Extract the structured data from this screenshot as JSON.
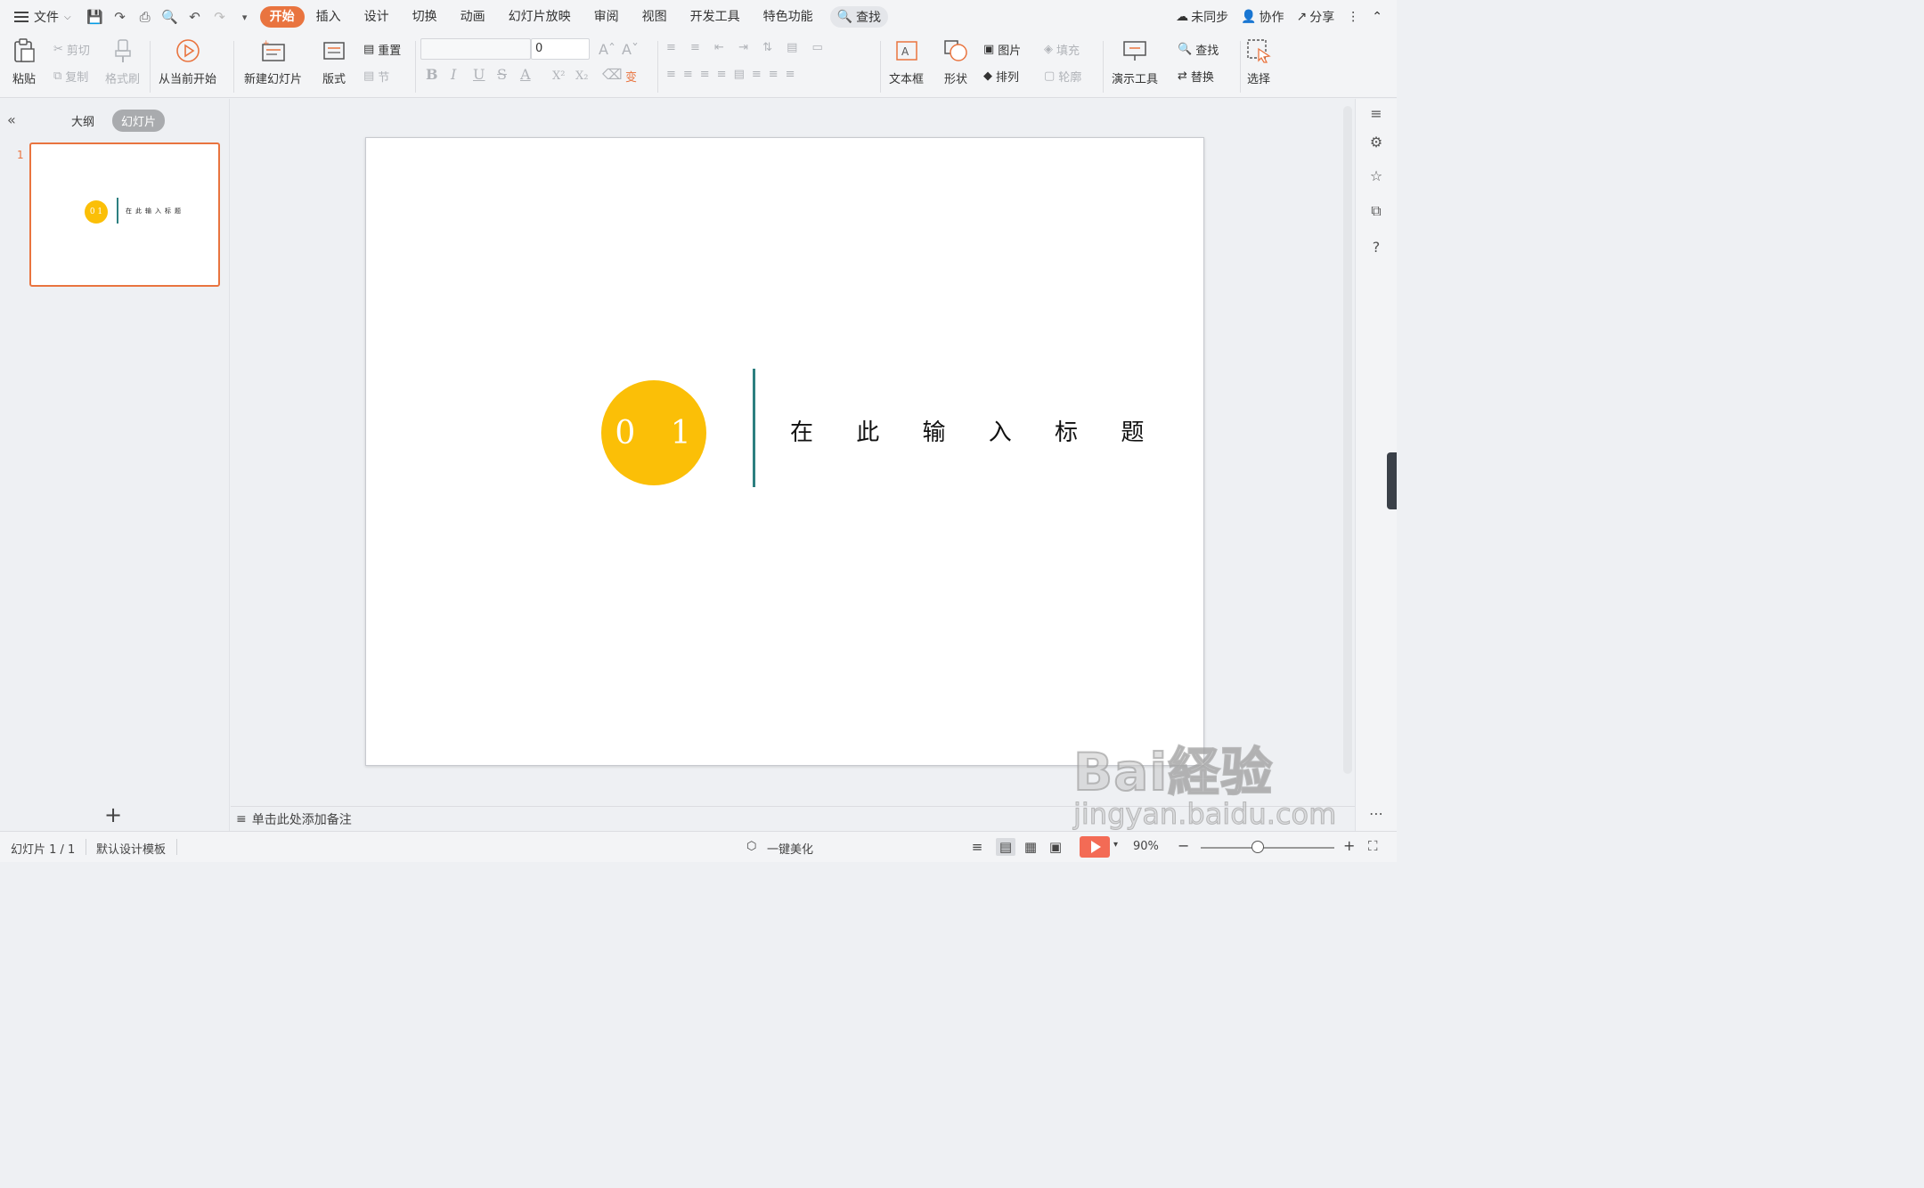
{
  "menubar": {
    "file_label": "文件",
    "tabs": [
      {
        "label": "开始",
        "active": true
      },
      {
        "label": "插入"
      },
      {
        "label": "设计"
      },
      {
        "label": "切换"
      },
      {
        "label": "动画"
      },
      {
        "label": "幻灯片放映"
      },
      {
        "label": "审阅"
      },
      {
        "label": "视图"
      },
      {
        "label": "开发工具"
      },
      {
        "label": "特色功能"
      }
    ],
    "search_label": "查找",
    "right": {
      "sync": "未同步",
      "collab": "协作",
      "share": "分享"
    }
  },
  "ribbon": {
    "paste": "粘贴",
    "cut": "剪切",
    "copy": "复制",
    "format_painter": "格式刷",
    "start_current": "从当前开始",
    "new_slide": "新建幻灯片",
    "layout": "版式",
    "reset": "重置",
    "section": "节",
    "font_size": "0",
    "textbox": "文本框",
    "shape": "形状",
    "picture": "图片",
    "arrange": "排列",
    "fill": "填充",
    "outline": "轮廓",
    "presentation_tools": "演示工具",
    "find": "查找",
    "replace": "替换",
    "select": "选择"
  },
  "leftpanel": {
    "tab_outline": "大纲",
    "tab_slides": "幻灯片",
    "slide_number": "1",
    "thumb_number": "0 1",
    "thumb_title": "在此输入标题"
  },
  "slide": {
    "number": "0 1",
    "title": "在 此 输 入 标 题",
    "circle_color": "#fbbf07",
    "line_color": "#2d7f80"
  },
  "notes": {
    "placeholder": "单击此处添加备注"
  },
  "status": {
    "slide_count": "幻灯片 1 / 1",
    "template": "默认设计模板",
    "beautify": "一键美化",
    "zoom": "90%"
  },
  "watermark": {
    "brand": "Bai経验",
    "url": "jingyan.baidu.com"
  },
  "colors": {
    "accent": "#e9743f",
    "play": "#f36b55"
  }
}
